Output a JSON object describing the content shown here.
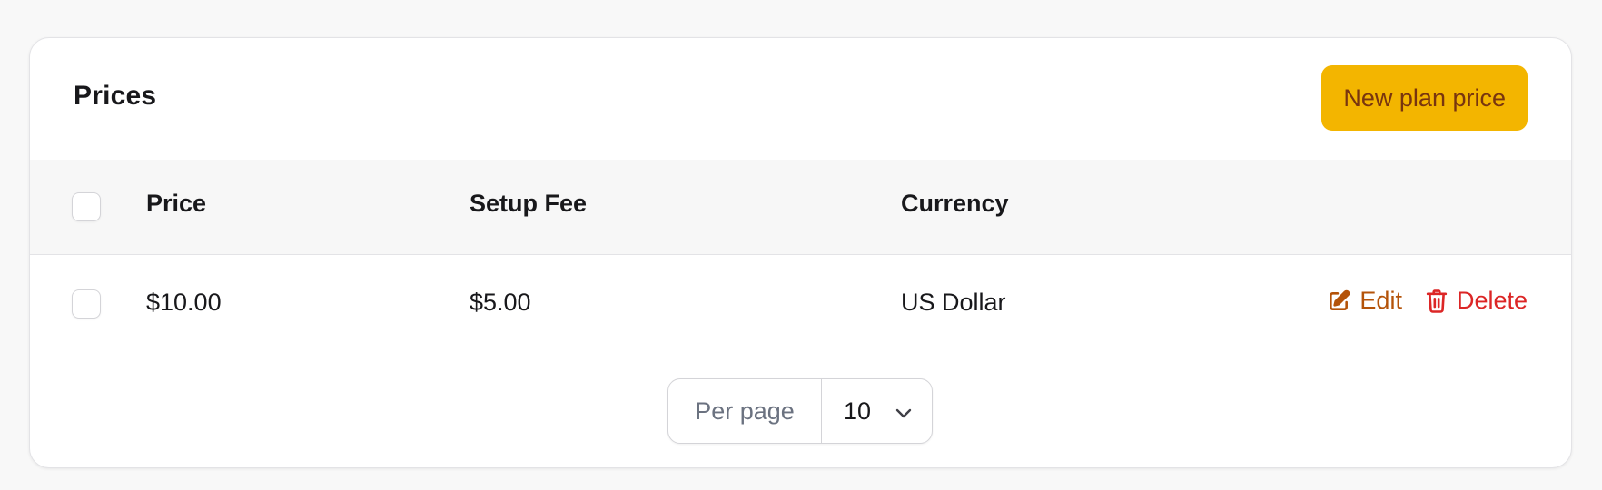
{
  "header": {
    "title": "Prices",
    "new_button_label": "New plan price"
  },
  "table": {
    "columns": [
      "Price",
      "Setup Fee",
      "Currency"
    ],
    "rows": [
      {
        "price": "$10.00",
        "setup_fee": "$5.00",
        "currency": "US Dollar",
        "edit_label": "Edit",
        "delete_label": "Delete"
      }
    ]
  },
  "pagination": {
    "per_page_label": "Per page",
    "per_page_value": "10"
  },
  "colors": {
    "primary_button_bg": "#f3b500",
    "primary_button_text": "#78350f",
    "edit": "#b45309",
    "delete": "#dc2626"
  },
  "icons": {
    "edit": "pencil-square-icon",
    "delete": "trash-icon",
    "select": "chevron-down-icon"
  }
}
